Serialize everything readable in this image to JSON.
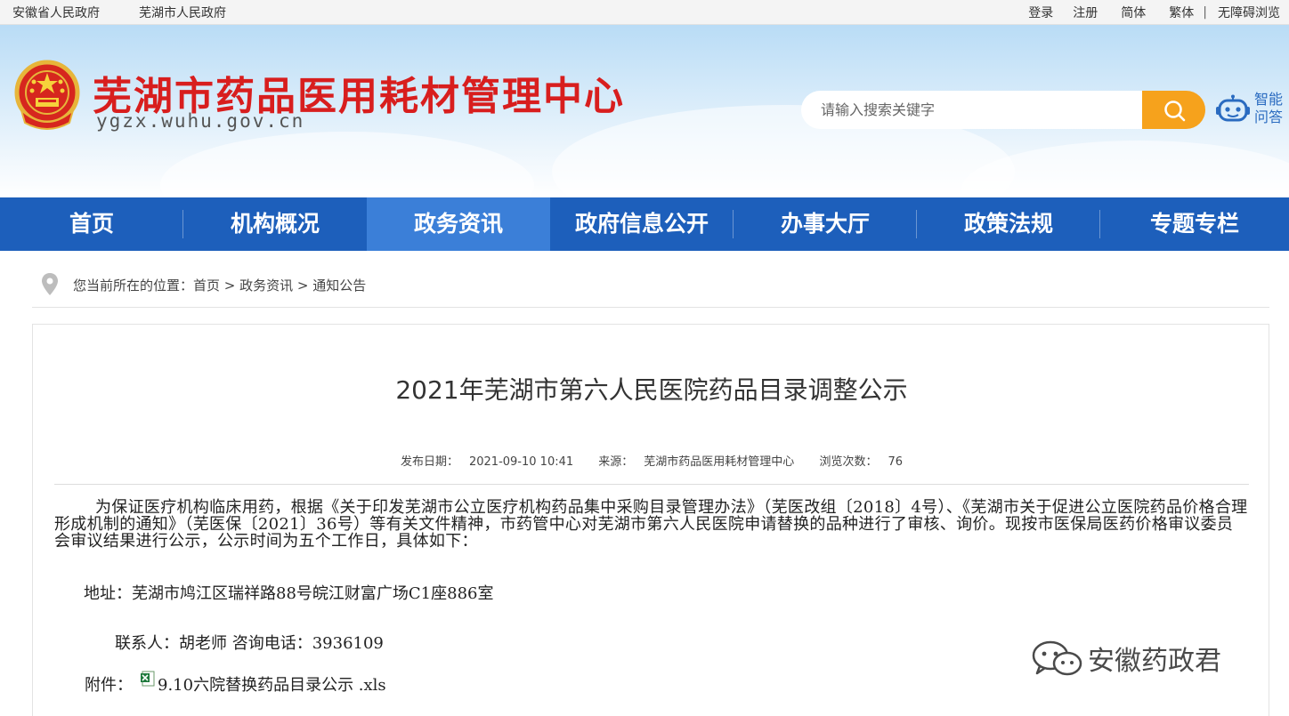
{
  "topbar": {
    "gov_links": [
      "安徽省人民政府",
      "芜湖市人民政府"
    ],
    "login": "登录",
    "register": "注册",
    "simplified": "简体",
    "traditional": "繁体",
    "separator": "|",
    "accessibility": "无障碍浏览"
  },
  "header": {
    "site_title": "芜湖市药品医用耗材管理中心",
    "site_domain": "ygzx.wuhu.gov.cn",
    "search_placeholder": "请输入搜索关键字",
    "qa_line1": "智能",
    "qa_line2": "问答",
    "emblem_icon": "national-emblem-icon",
    "search_icon": "search-icon",
    "robot_icon": "robot-icon"
  },
  "nav": {
    "items": [
      "首页",
      "机构概况",
      "政务资讯",
      "政府信息公开",
      "办事大厅",
      "政策法规",
      "专题专栏"
    ],
    "active_index": 2,
    "color": "#1d5fbb",
    "active_color": "#3b7fd8"
  },
  "breadcrumb": {
    "label": "您当前所在的位置：",
    "path": "首页 > 政务资讯 > 通知公告"
  },
  "article": {
    "title": "2021年芜湖市第六人民医院药品目录调整公示",
    "publish_label": "发布日期：",
    "publish_date": "2021-09-10 10:41",
    "source_label": "来源：",
    "source": "芜湖市药品医用耗材管理中心",
    "views_label": "浏览次数：",
    "views": "76",
    "paragraph": "为保证医疗机构临床用药，根据《关于印发芜湖市公立医疗机构药品集中采购目录管理办法》（芜医改组〔2018〕4号）、《芜湖市关于促进公立医院药品价格合理形成机制的通知》（芜医保〔2021〕36号）等有关文件精神，市药管中心对芜湖市第六人民医院申请替换的品种进行了审核、询价。现按市医保局医药价格审议委员会审议结果进行公示，公示时间为五个工作日，具体如下：",
    "address": "地址：芜湖市鸠江区瑞祥路88号皖江财富广场C1座886室",
    "contact": "联系人：胡老师 咨询电话：3936109",
    "attachment_label": "附件：",
    "attachment_file": "9.10六院替换药品目录公示 .xls",
    "attachment_icon": "excel-file-icon"
  },
  "watermark": {
    "text": "安徽药政君",
    "icon": "wechat-icon"
  }
}
